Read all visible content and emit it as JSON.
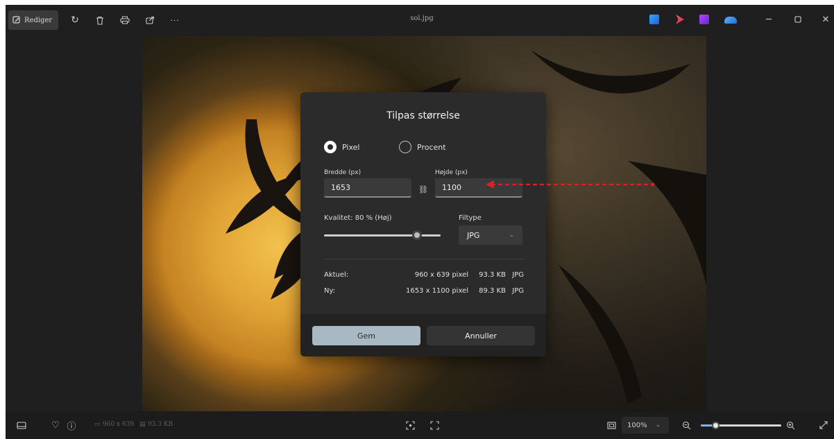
{
  "titlebar": {
    "edit_label": "Rediger",
    "title": "sol.jpg"
  },
  "dialog": {
    "title": "Tilpas størrelse",
    "mode_pixel": "Pixel",
    "mode_percent": "Procent",
    "selected_mode": "Pixel",
    "width_label": "Bredde (px)",
    "width_value": "1653",
    "height_label": "Højde (px)",
    "height_value": "1100",
    "quality_label": "Kvalitet: 80 % (Høj)",
    "quality_value": 80,
    "filetype_label": "Filtype",
    "filetype_value": "JPG",
    "current": {
      "label": "Aktuel:",
      "dims": "960 x 639 pixel",
      "size": "93.3 KB",
      "type": "JPG"
    },
    "new": {
      "label": "Ny:",
      "dims": "1653 x 1100 pixel",
      "size": "89.3 KB",
      "type": "JPG"
    },
    "save_label": "Gem",
    "cancel_label": "Annuller"
  },
  "bottombar": {
    "dims": "960 x 639",
    "size": "93.3 KB",
    "zoom": "100%",
    "zoom_level": 0.18
  },
  "colors": {
    "accent_save": "#a9b9c4",
    "annotation_arrow": "#e02020"
  },
  "icons": {
    "rotate": "rotate-icon",
    "delete": "trash-icon",
    "print": "print-icon",
    "share": "share-icon",
    "more": "more-icon",
    "link": "link-icon"
  }
}
